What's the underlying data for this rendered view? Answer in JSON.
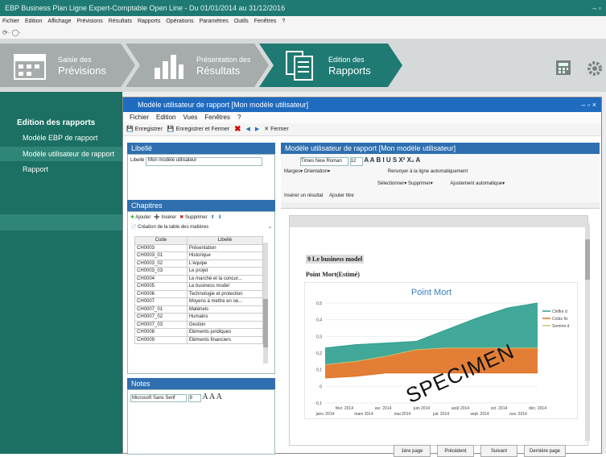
{
  "app": {
    "title": "EBP Business Plan Ligne Expert-Comptable Open Line - Du 01/01/2014 au 31/12/2016",
    "window_controls": "– ▫",
    "menu": [
      "Fichier",
      "Edition",
      "Affichage",
      "Prévisions",
      "Résultats",
      "Rapports",
      "Opérations",
      "Paramètres",
      "Outils",
      "Fenêtres",
      "?"
    ],
    "quick_access": "⟳· ◯·"
  },
  "ribbon": {
    "steps": [
      {
        "line1": "Saisie des",
        "line2": "Prévisions"
      },
      {
        "line1": "Présentation des",
        "line2": "Résultats"
      },
      {
        "line1": "Edition des",
        "line2": "Rapports"
      }
    ]
  },
  "sidebar": {
    "title": "Edition des rapports",
    "items": [
      "Modèle EBP de rapport",
      "Modèle utilisateur de rapport",
      "Rapport"
    ]
  },
  "dialog": {
    "title": "Modèle utilisateur de rapport [Mon modèle utilisateur]",
    "controls": "– ▫ ×",
    "menu": [
      "Fichier",
      "Edition",
      "Vues",
      "Fenêtres",
      "?"
    ],
    "toolbar": {
      "save": "Enregistrer",
      "save_close": "Enregistrer et Fermer",
      "close": "Fermer"
    },
    "libelle": {
      "header": "Libellé",
      "label": "Libellé",
      "value": "Mon modèle utilisateur"
    },
    "chapitres": {
      "header": "Chapitres",
      "add": "Ajouter",
      "insert": "Insérer",
      "delete": "Supprimer",
      "toc": "Création de la table des matières",
      "columns": [
        "Code",
        "Libellé"
      ],
      "rows": [
        [
          "CH0003",
          "Présentation"
        ],
        [
          "CH0003_01",
          "Historique"
        ],
        [
          "CH0003_02",
          "L'équipe"
        ],
        [
          "CH0003_03",
          "Le projet"
        ],
        [
          "CH0004",
          "Le marché et la concur..."
        ],
        [
          "CH0005",
          "Le business model"
        ],
        [
          "CH0006",
          "Technologie et protection"
        ],
        [
          "CH0007",
          "Moyens à mettre en oe..."
        ],
        [
          "CH0007_01",
          "Matériels"
        ],
        [
          "CH0007_02",
          "Humains"
        ],
        [
          "CH0007_03",
          "Gestion"
        ],
        [
          "CH0008",
          "Eléments juridiques"
        ],
        [
          "CH0009",
          "Eléments financiers"
        ]
      ]
    },
    "notes": {
      "header": "Notes",
      "font": "Microsoft Sans Serif",
      "size": "8",
      "format_buttons": "A A A"
    },
    "editor": {
      "header": "Modèle utilisateur de rapport [Mon modèle utilisateur]",
      "font": "Times New Roman",
      "size": "12",
      "format_row": "A A B I U S X² X₂ A",
      "row2": {
        "margins": "Marges",
        "orientation": "Orientation",
        "wrap": "Renvoyer à la ligne automatiquement"
      },
      "row3": {
        "select": "Sélectionner",
        "delete": "Supprimer",
        "autofit": "Ajustement automatique"
      },
      "row4": {
        "insert_result": "Insérer un résultat",
        "add_title": "Ajouter titre"
      },
      "section_title": "9 Le business model",
      "chart_caption": "Point Mort(Estimé)",
      "watermark": "SPECIMEN",
      "nav": [
        "1ère page",
        "Précédent",
        "Suivant",
        "Dernière page"
      ]
    }
  },
  "chart_data": {
    "type": "area",
    "title": "Point Mort",
    "x_top": [
      "févr. 2014",
      "avr. 2014",
      "juin 2014",
      "août 2014",
      "oct. 2014",
      "déc. 2014"
    ],
    "x_bottom": [
      "janv. 2014",
      "mars 2014",
      "mai 2014",
      "juil. 2014",
      "sept. 2014",
      "nov. 2014"
    ],
    "y_ticks": [
      "0,5",
      "0,4",
      "0,3",
      "0,2",
      "0,1",
      "0",
      "-0,1"
    ],
    "ylim": [
      -0.1,
      0.5
    ],
    "legend": [
      "Chiffre d",
      "Coûts fix",
      "Somme d"
    ],
    "series": [
      {
        "name": "Chiffre d",
        "color": "#2e9e8e",
        "values": [
          0.23,
          0.25,
          0.26,
          0.27,
          0.34,
          0.41,
          0.47,
          0.5
        ]
      },
      {
        "name": "Coûts fix",
        "color": "#e07020",
        "values": [
          0.05,
          0.06,
          0.08,
          0.08,
          0.08,
          0.08,
          0.08,
          0.08
        ]
      },
      {
        "name": "Somme d",
        "color": "#c8c070",
        "values": [
          0.13,
          0.15,
          0.18,
          0.22,
          0.23,
          0.23,
          0.23,
          0.23
        ]
      }
    ]
  }
}
